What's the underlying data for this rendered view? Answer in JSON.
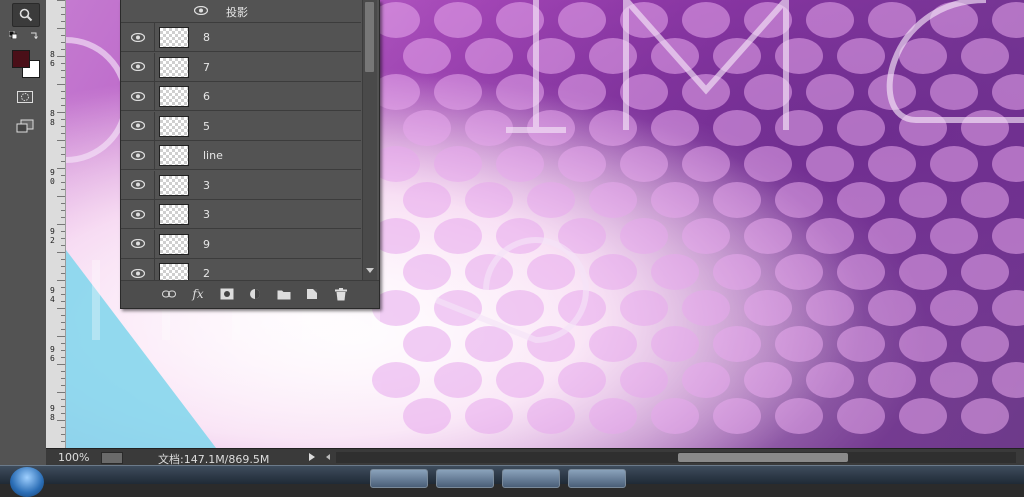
{
  "toolbar": {
    "tools": [
      {
        "icon": "zoom-icon",
        "active": true
      },
      {
        "icon": "default-colors-icon"
      },
      {
        "icon": "swap-colors-icon"
      },
      {
        "icon": "quick-mask-icon"
      },
      {
        "icon": "screen-mode-icon"
      }
    ],
    "foreground_color": "#4a0f18",
    "background_color": "#ffffff"
  },
  "ruler": {
    "labels": [
      "8\n6",
      "8\n8",
      "9\n0",
      "9\n2",
      "9\n4",
      "9\n6",
      "9\n8"
    ]
  },
  "layers_panel": {
    "effect_row": {
      "label": "投影",
      "icon": "eye-icon"
    },
    "layers": [
      {
        "name": "8",
        "visible": true
      },
      {
        "name": "7",
        "visible": true
      },
      {
        "name": "6",
        "visible": true
      },
      {
        "name": "5",
        "visible": true
      },
      {
        "name": "line",
        "visible": true
      },
      {
        "name": "3",
        "visible": true
      },
      {
        "name": "3",
        "visible": true
      },
      {
        "name": "9",
        "visible": true
      },
      {
        "name": "2",
        "visible": true
      }
    ],
    "footer": {
      "fx_label": "fx",
      "buttons": [
        "link-layers-icon",
        "fx-icon",
        "add-mask-icon",
        "adjustment-layer-icon",
        "new-group-icon",
        "new-layer-icon",
        "delete-layer-icon"
      ]
    }
  },
  "statusbar": {
    "zoom": "100%",
    "doc_info": "文档:147.1M/869.5M"
  },
  "colors": {
    "panel_bg": "#535353",
    "canvas_accent": "#b14cc0"
  }
}
